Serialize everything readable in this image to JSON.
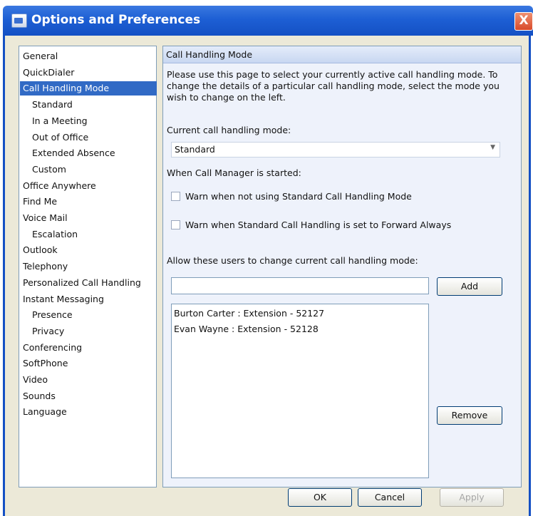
{
  "window": {
    "title": "Options and Preferences",
    "close_label": "X"
  },
  "sidebar": {
    "items": [
      {
        "label": "General",
        "indent": false,
        "selected": false
      },
      {
        "label": "QuickDialer",
        "indent": false,
        "selected": false
      },
      {
        "label": "Call Handling Mode",
        "indent": false,
        "selected": true
      },
      {
        "label": "Standard",
        "indent": true,
        "selected": false
      },
      {
        "label": "In a Meeting",
        "indent": true,
        "selected": false
      },
      {
        "label": "Out of Office",
        "indent": true,
        "selected": false
      },
      {
        "label": "Extended Absence",
        "indent": true,
        "selected": false
      },
      {
        "label": "Custom",
        "indent": true,
        "selected": false
      },
      {
        "label": "Office Anywhere",
        "indent": false,
        "selected": false
      },
      {
        "label": "Find Me",
        "indent": false,
        "selected": false
      },
      {
        "label": "Voice Mail",
        "indent": false,
        "selected": false
      },
      {
        "label": "Escalation",
        "indent": true,
        "selected": false
      },
      {
        "label": "Outlook",
        "indent": false,
        "selected": false
      },
      {
        "label": "Telephony",
        "indent": false,
        "selected": false
      },
      {
        "label": "Personalized Call Handling",
        "indent": false,
        "selected": false
      },
      {
        "label": "Instant Messaging",
        "indent": false,
        "selected": false
      },
      {
        "label": "Presence",
        "indent": true,
        "selected": false
      },
      {
        "label": "Privacy",
        "indent": true,
        "selected": false
      },
      {
        "label": "Conferencing",
        "indent": false,
        "selected": false
      },
      {
        "label": "SoftPhone",
        "indent": false,
        "selected": false
      },
      {
        "label": "Video",
        "indent": false,
        "selected": false
      },
      {
        "label": "Sounds",
        "indent": false,
        "selected": false
      },
      {
        "label": "Language",
        "indent": false,
        "selected": false
      }
    ]
  },
  "panel": {
    "header": "Call Handling Mode",
    "description": "Please use this page to select your currently active call handling mode. To change the details of a particular call handling mode, select the mode you wish to change on the left.",
    "current_mode_label": "Current call handling mode:",
    "current_mode_value": "Standard",
    "started_label": "When Call Manager is started:",
    "warn_not_standard": "Warn when not using Standard Call Handling Mode",
    "warn_forward": "Warn when Standard Call Handling is set to Forward Always",
    "allow_users_label": "Allow these users to change current call handling mode:",
    "user_input_value": "",
    "add_label": "Add",
    "remove_label": "Remove",
    "users": [
      "Burton Carter : Extension - 52127",
      "Evan Wayne : Extension - 52128"
    ]
  },
  "footer": {
    "ok_label": "OK",
    "cancel_label": "Cancel",
    "apply_label": "Apply"
  }
}
